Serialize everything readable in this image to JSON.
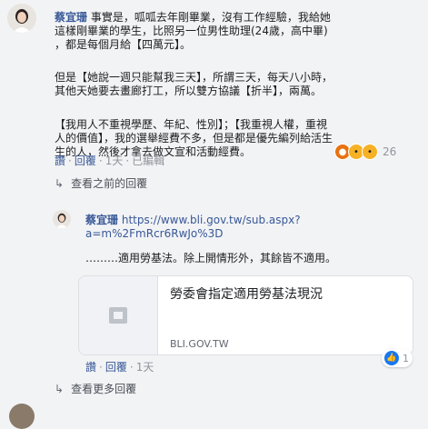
{
  "comment1": {
    "author": "蔡宜珊",
    "p1_after_name": " 事實是，呱呱去年剛畢業，沒有工作經驗，我給她",
    "p1_line2": "這樣剛畢業的學生，比照另一位男性助理(24歲，高中畢)",
    "p1_line3": "，都是每個月給【四萬元】。",
    "p2_line1": "但是【她說一週只能幫我三天】，所謂三天，每天八小時，",
    "p2_line2": "其他天她要去畫廊打工，所以雙方協議【折半】，兩萬。",
    "p3_line1": "【我用人不重視學歷、年紀、性別】；【我重視人權，重視",
    "p3_line2": "人的價值】，我的選舉經費不多，但是都是優先編列給活生",
    "p3_line3": "生的人，然後才拿去做文宣和活動經費。",
    "reaction_count": "26",
    "actions": {
      "reply1": "讚",
      "reply2": "回覆",
      "time": "1天",
      "edited": "已編輯"
    }
  },
  "view_previous": "查看之前的回覆",
  "comment2": {
    "author": "蔡宜珊",
    "url_line1": "https://www.bli.gov.tw/sub.aspx?",
    "url_line2": "a=m%2FmRcr6RwJo%3D",
    "text": "………適用勞基法。除上開情形外，其餘皆不適用。",
    "card_title": "勞委會指定適用勞基法現況",
    "card_domain": "BLI.GOV.TW",
    "like_count": "1",
    "actions": {
      "like": "讚",
      "reply": "回覆",
      "time": "1天"
    }
  },
  "view_more": "查看更多回覆"
}
